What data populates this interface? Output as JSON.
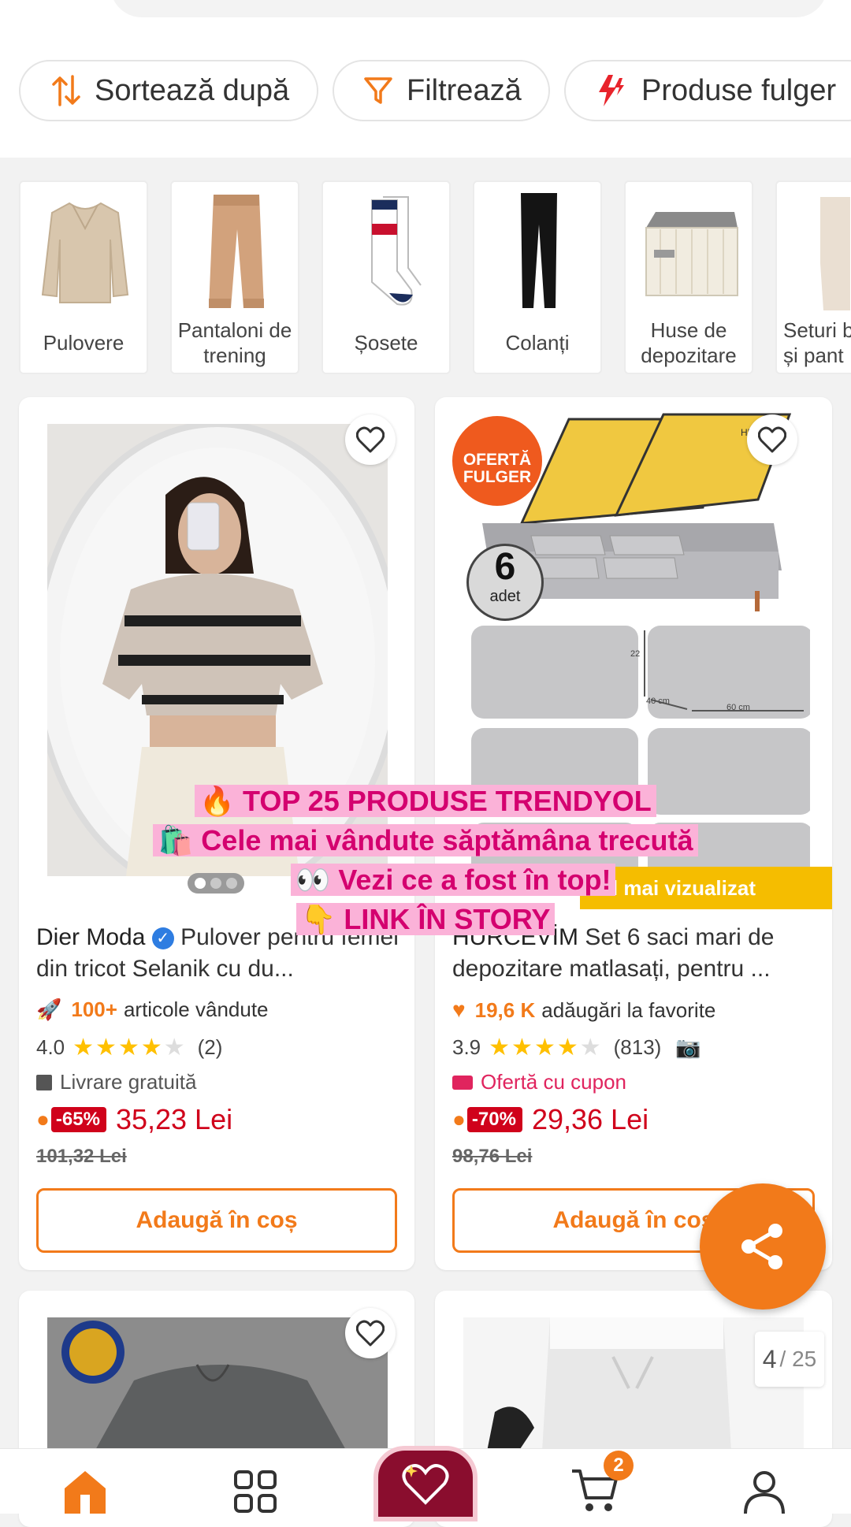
{
  "toolbar": {
    "sort_label": "Sortează după",
    "filter_label": "Filtrează",
    "flash_label": "Produse fulger"
  },
  "categories": [
    {
      "label": "Pulovere"
    },
    {
      "label": "Pantaloni de trening"
    },
    {
      "label": "Șosete"
    },
    {
      "label": "Colanți"
    },
    {
      "label": "Huse de depozitare"
    },
    {
      "label": "Seturi b și pant"
    }
  ],
  "products": [
    {
      "brand": "Dier Moda",
      "title": "Pulover pentru femei din tricot Selanik cu du...",
      "metric_value": "100+",
      "metric_text": "articole vândute",
      "rating": "4.0",
      "reviews": "(2)",
      "extra": "Livrare gratuită",
      "discount": "-65%",
      "price": "35,23 Lei",
      "old_price": "101,32 Lei",
      "add_label": "Adaugă în coș"
    },
    {
      "brand": "HURCEVİM",
      "title": "Set 6 saci mari de depozitare matlasați, pentru ...",
      "badge": "OFERTĂ FULGER",
      "count_badge_number": "6",
      "count_badge_text": "adet",
      "image_brand": "HURCEVİM",
      "dim_labels": [
        "22",
        "40 cm",
        "60 cm"
      ],
      "ribbon": "cel mai vizualizat",
      "metric_value": "19,6 K",
      "metric_text": "adăugări la favorite",
      "rating": "3.9",
      "reviews": "(813)",
      "extra": "Ofertă cu cupon",
      "discount": "-70%",
      "price": "29,36 Lei",
      "old_price": "98,76 Lei",
      "add_label": "Adaugă în coș"
    }
  ],
  "overlay": {
    "line1": "🔥 TOP 25 PRODUSE TRENDYOL",
    "line2": "🛍️ Cele mai vândute săptămâna trecută",
    "line3": "👀 Vezi ce a fost în top!",
    "line4": "👇 LINK ÎN STORY"
  },
  "pager": {
    "current": "4",
    "total": "/ 25"
  },
  "nav": {
    "cart_count": "2"
  },
  "colors": {
    "accent": "#f27a1a",
    "price": "#d0021b",
    "overlay_text": "#d4006f"
  }
}
